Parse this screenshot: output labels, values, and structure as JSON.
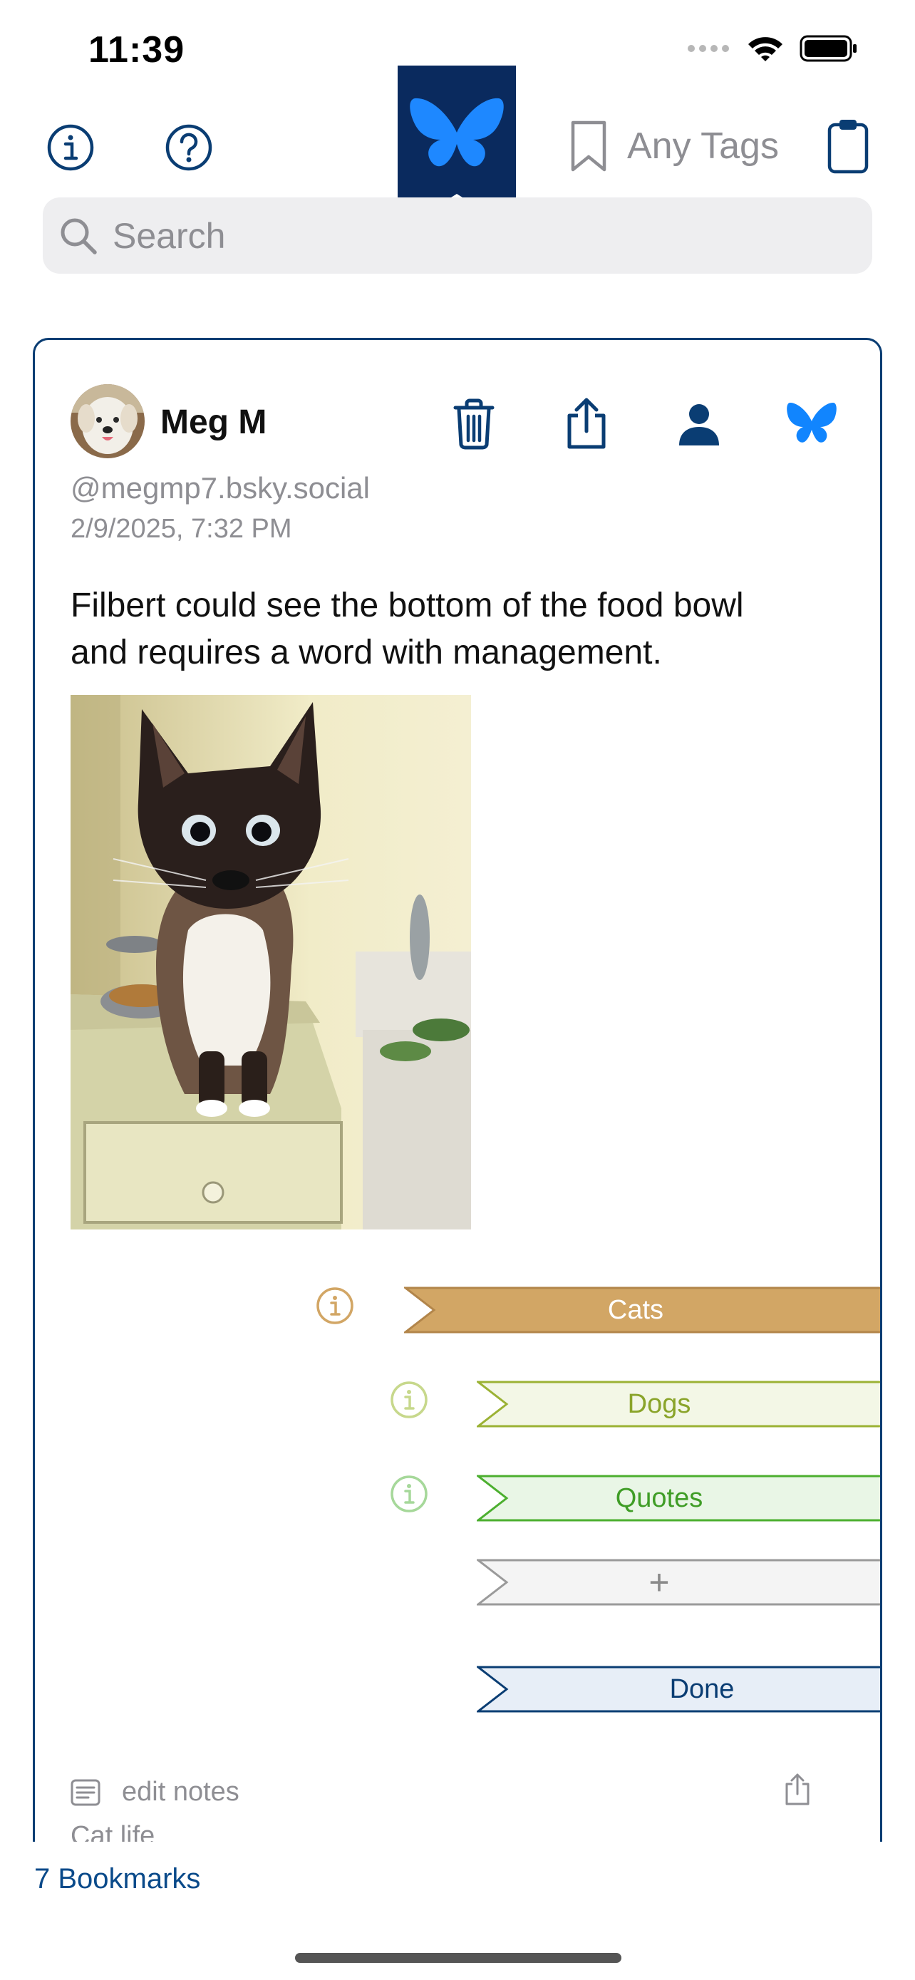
{
  "status_bar": {
    "time": "11:39"
  },
  "toolbar": {
    "tags_label": "Any Tags"
  },
  "search": {
    "placeholder": "Search"
  },
  "post": {
    "author_name": "Meg M",
    "handle": "@megmp7.bsky.social",
    "timestamp": "2/9/2025, 7:32 PM",
    "text_lines": [
      "Filbert could see the bottom of the food bowl",
      "and requires a word with management."
    ]
  },
  "tags": [
    {
      "label": "Cats",
      "fill": "#d2a665",
      "stroke": "#b2854a",
      "text": "#ffffff"
    },
    {
      "label": "Dogs",
      "fill": "#f3f7e6",
      "stroke": "#9bb234",
      "text": "#8aa42a"
    },
    {
      "label": "Quotes",
      "fill": "#e9f6e6",
      "stroke": "#4caf2f",
      "text": "#3f9d26"
    },
    {
      "label": "+",
      "fill": "#f4f4f4",
      "stroke": "#9a9a9a",
      "text": "#8a8a8a"
    },
    {
      "label": "Done",
      "fill": "#e7eef7",
      "stroke": "#0a3d73",
      "text": "#0a3d73"
    }
  ],
  "notes": {
    "edit_label": "edit notes",
    "text": "Cat life"
  },
  "footer": {
    "bookmarks_count": "7 Bookmarks"
  },
  "colors": {
    "navy": "#0a3d73",
    "bluesky_blue": "#1185fe",
    "accent_blue": "#0a4a8a"
  }
}
